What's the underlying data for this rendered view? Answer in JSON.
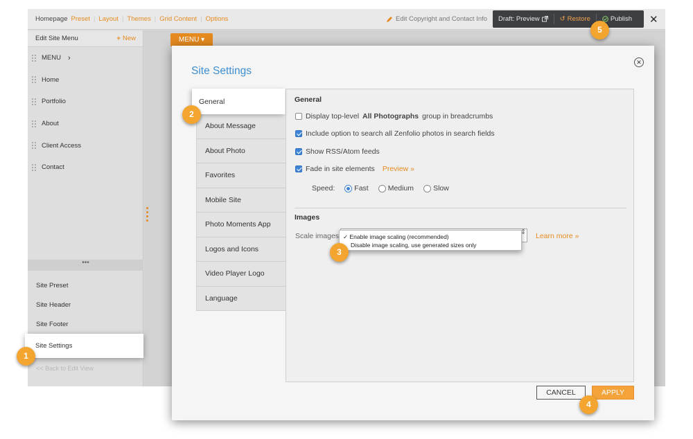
{
  "topnav": {
    "items": [
      "Homepage",
      "Preset",
      "Layout",
      "Themes",
      "Grid Content",
      "Options"
    ]
  },
  "toolbar": {
    "edit_copyright": "Edit Copyright and Contact Info",
    "draft_preview": "Draft: Preview",
    "restore": "Restore",
    "publish": "Publish"
  },
  "sidebar": {
    "header": "Edit Site Menu",
    "new_label": "New",
    "items": [
      "MENU",
      "Home",
      "Portfolio",
      "About",
      "Client Access",
      "Contact"
    ],
    "lower_items": [
      "Site Preset",
      "Site Header",
      "Site Footer",
      "Site Settings"
    ],
    "back_link": "<< Back to Edit View"
  },
  "canvas": {
    "menu_tab": "MENU ▾"
  },
  "modal": {
    "title": "Site Settings",
    "tabs": [
      "General",
      "About Message",
      "About Photo",
      "Favorites",
      "Mobile Site",
      "Photo Moments App",
      "Logos and Icons",
      "Video Player Logo",
      "Language"
    ],
    "active_tab": "General",
    "general": {
      "heading": "General",
      "opt1_pre": "Display top-level",
      "opt1_bold": "All Photographs",
      "opt1_post": "group in breadcrumbs",
      "opt1_checked": false,
      "opt2": "Include option to search all Zenfolio photos in search fields",
      "opt2_checked": true,
      "opt3": "Show RSS/Atom feeds",
      "opt3_checked": true,
      "opt4": "Fade in site elements",
      "opt4_checked": true,
      "preview_link": "Preview »",
      "speed_label": "Speed:",
      "speed_options": [
        "Fast",
        "Medium",
        "Slow"
      ],
      "speed_selected": "Fast"
    },
    "images": {
      "heading": "Images",
      "scale_label": "Scale images",
      "dropdown_options": [
        "Enable image scaling (recommended)",
        "Disable image scaling, use generated sizes only"
      ],
      "selected_option": "Enable image scaling (recommended)",
      "learn_more": "Learn more »"
    },
    "buttons": {
      "cancel": "CANCEL",
      "apply": "APPLY"
    }
  },
  "badges": [
    "1",
    "2",
    "3",
    "4",
    "5"
  ],
  "colors": {
    "accent": "#e58a1f",
    "title_blue": "#3d8fd1",
    "checkbox_blue": "#3f85d6",
    "badge": "#f3a530"
  }
}
